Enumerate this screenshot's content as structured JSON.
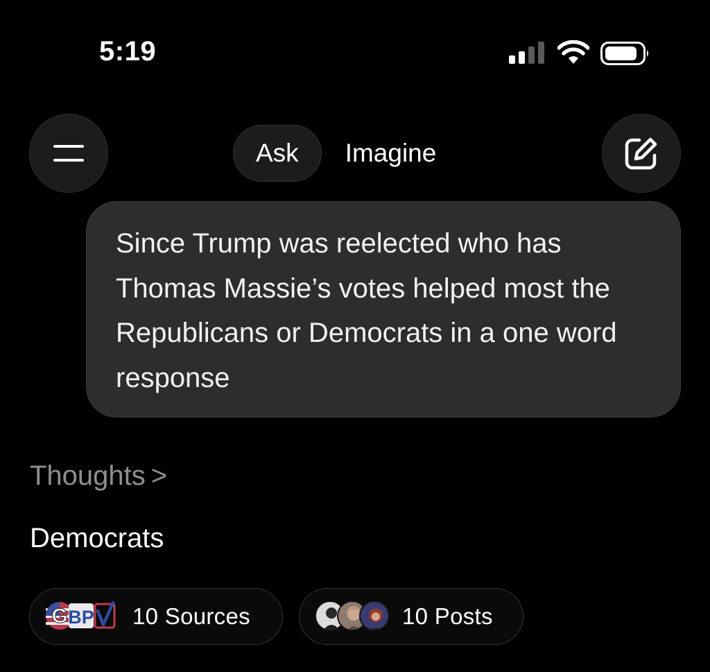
{
  "status_bar": {
    "time": "5:19",
    "signal_icon": "cellular-signal-icon",
    "wifi_icon": "wifi-icon",
    "battery_icon": "battery-icon"
  },
  "header": {
    "menu_icon": "hamburger-menu-icon",
    "tabs": [
      {
        "label": "Ask",
        "selected": true
      },
      {
        "label": "Imagine",
        "selected": false
      }
    ],
    "compose_icon": "compose-icon"
  },
  "conversation": {
    "user_query": "Since Trump was reelected who has Thomas Massie’s votes helped most the Republicans or Democrats in a one word response",
    "thoughts_label": "Thoughts",
    "thoughts_chevron": ">",
    "answer": "Democrats"
  },
  "footer_pills": {
    "sources_label": "10 Sources",
    "posts_label": "10 Posts",
    "source_logos": [
      "G",
      "BP",
      "V"
    ]
  },
  "colors": {
    "background": "#000000",
    "bubble": "#2d2d2f",
    "muted_text": "#8e8e93"
  }
}
